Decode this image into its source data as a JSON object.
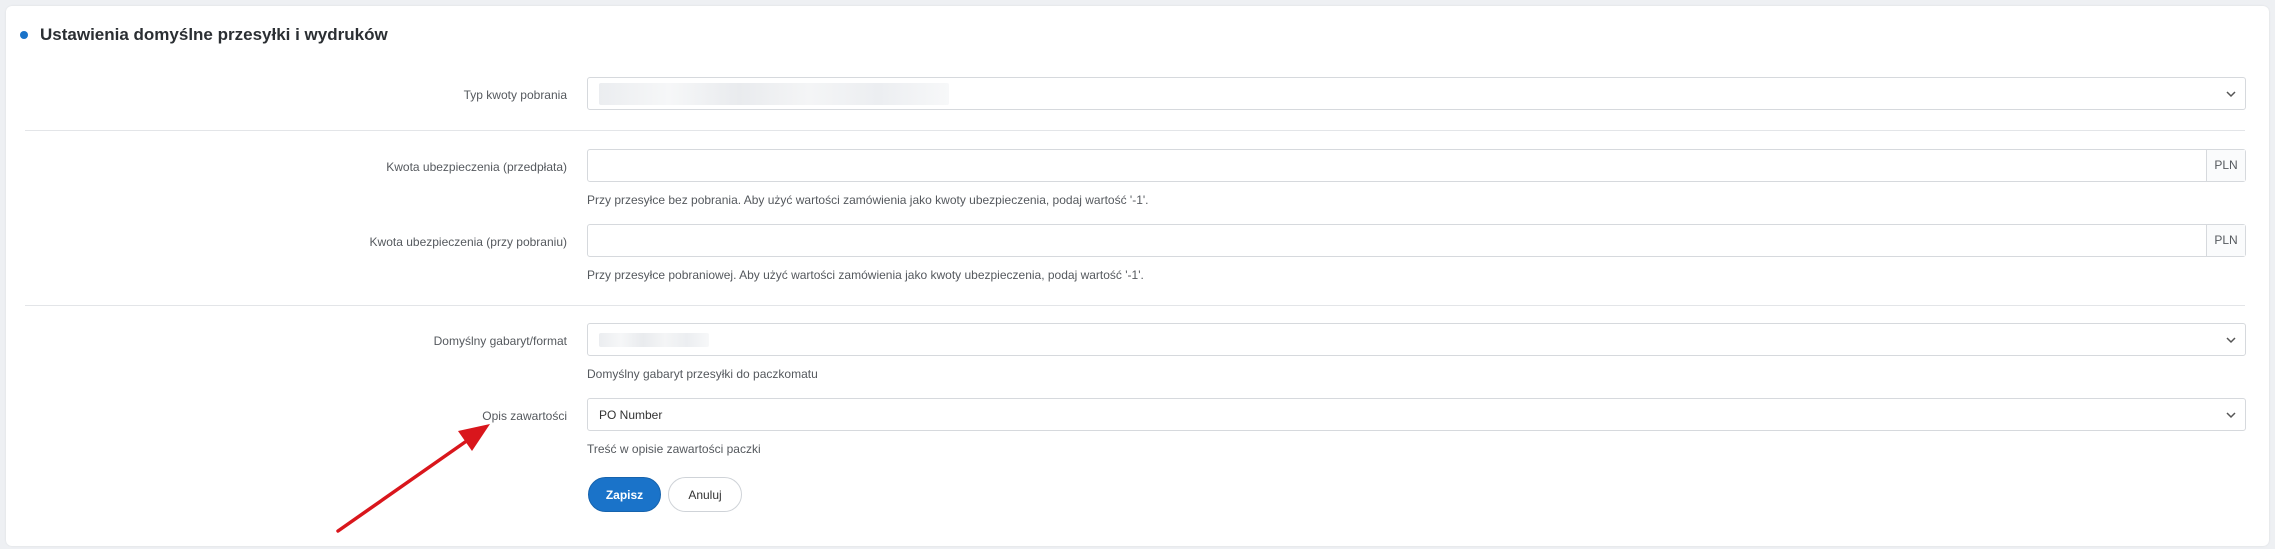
{
  "section": {
    "title": "Ustawienia domyślne przesyłki i wydruków"
  },
  "fields": {
    "cod_type": {
      "label": "Typ kwoty pobrania",
      "value": ""
    },
    "insurance_prepaid": {
      "label": "Kwota ubezpieczenia (przedpłata)",
      "value": "",
      "currency": "PLN",
      "help": "Przy przesyłce bez pobrania. Aby użyć wartości zamówienia jako kwoty ubezpieczenia, podaj wartość '-1'."
    },
    "insurance_cod": {
      "label": "Kwota ubezpieczenia (przy pobraniu)",
      "value": "",
      "currency": "PLN",
      "help": "Przy przesyłce pobraniowej. Aby użyć wartości zamówienia jako kwoty ubezpieczenia, podaj wartość '-1'."
    },
    "default_size": {
      "label": "Domyślny gabaryt/format",
      "value": "",
      "help": "Domyślny gabaryt przesyłki do paczkomatu"
    },
    "content_description": {
      "label": "Opis zawartości",
      "value": "PO Number",
      "help": "Treść w opisie zawartości paczki"
    }
  },
  "buttons": {
    "save": "Zapisz",
    "cancel": "Anuluj"
  },
  "colors": {
    "accent": "#1a73c9",
    "annotation_arrow": "#d9161c"
  },
  "icons": {
    "dropdown": "chevron-down-icon",
    "bullet": "dot-icon",
    "annotation": "arrow-annotation"
  }
}
